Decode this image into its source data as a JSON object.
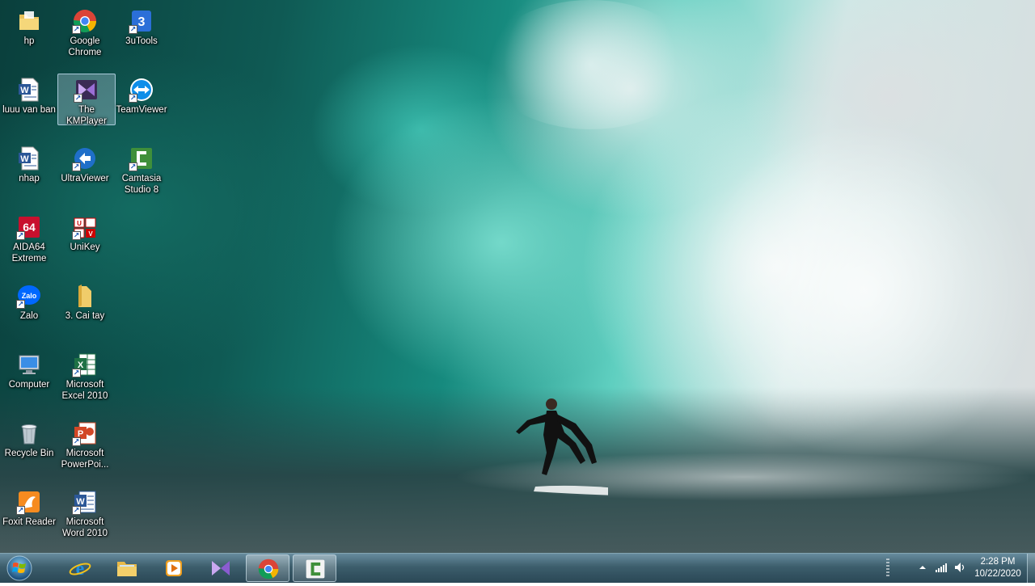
{
  "desktop": {
    "icons": [
      {
        "label": "hp",
        "icon": "user-folder-icon"
      },
      {
        "label": "Google Chrome",
        "icon": "chrome-icon"
      },
      {
        "label": "3uTools",
        "icon": "3utools-icon"
      },
      {
        "label": "luuu van ban",
        "icon": "word-doc-icon"
      },
      {
        "label": "The KMPlayer",
        "icon": "kmplayer-icon"
      },
      {
        "label": "TeamViewer",
        "icon": "teamviewer-icon"
      },
      {
        "label": "nhap",
        "icon": "word-doc-icon"
      },
      {
        "label": "UltraViewer",
        "icon": "ultraviewer-icon"
      },
      {
        "label": "Camtasia Studio 8",
        "icon": "camtasia-icon"
      },
      {
        "label": "AIDA64 Extreme",
        "icon": "aida64-icon"
      },
      {
        "label": "UniKey",
        "icon": "unikey-icon"
      },
      {
        "label": "Zalo",
        "icon": "zalo-icon"
      },
      {
        "label": "3. Cai tay",
        "icon": "folder-icon"
      },
      {
        "label": "Computer",
        "icon": "computer-icon"
      },
      {
        "label": "Microsoft Excel 2010",
        "icon": "excel-icon"
      },
      {
        "label": "Recycle Bin",
        "icon": "recycle-bin-icon"
      },
      {
        "label": "Microsoft PowerPoi...",
        "icon": "powerpoint-icon"
      },
      {
        "label": "Foxit Reader",
        "icon": "foxit-icon"
      },
      {
        "label": "Microsoft Word 2010",
        "icon": "word-icon"
      }
    ],
    "selected": "The KMPlayer"
  },
  "taskbar": {
    "start": "windows-start-icon",
    "pinned": [
      {
        "icon": "internet-explorer-icon"
      },
      {
        "icon": "file-explorer-icon"
      },
      {
        "icon": "media-player-icon"
      },
      {
        "icon": "kmplayer-icon"
      },
      {
        "icon": "chrome-icon",
        "active": true
      },
      {
        "icon": "camtasia-icon",
        "active": true
      }
    ],
    "tray": {
      "icons": [
        "show-hidden-icons-icon",
        "network-signal-icon",
        "volume-icon"
      ],
      "time": "2:28 PM",
      "date": "10/22/2020"
    }
  },
  "colors": {
    "word_blue": "#2b5797",
    "excel_green": "#1e7145",
    "powerpoint_orange": "#d24726",
    "chrome_red": "#db4437",
    "chrome_yellow": "#f4b400",
    "chrome_green": "#0f9d58",
    "chrome_blue": "#4285f4"
  }
}
